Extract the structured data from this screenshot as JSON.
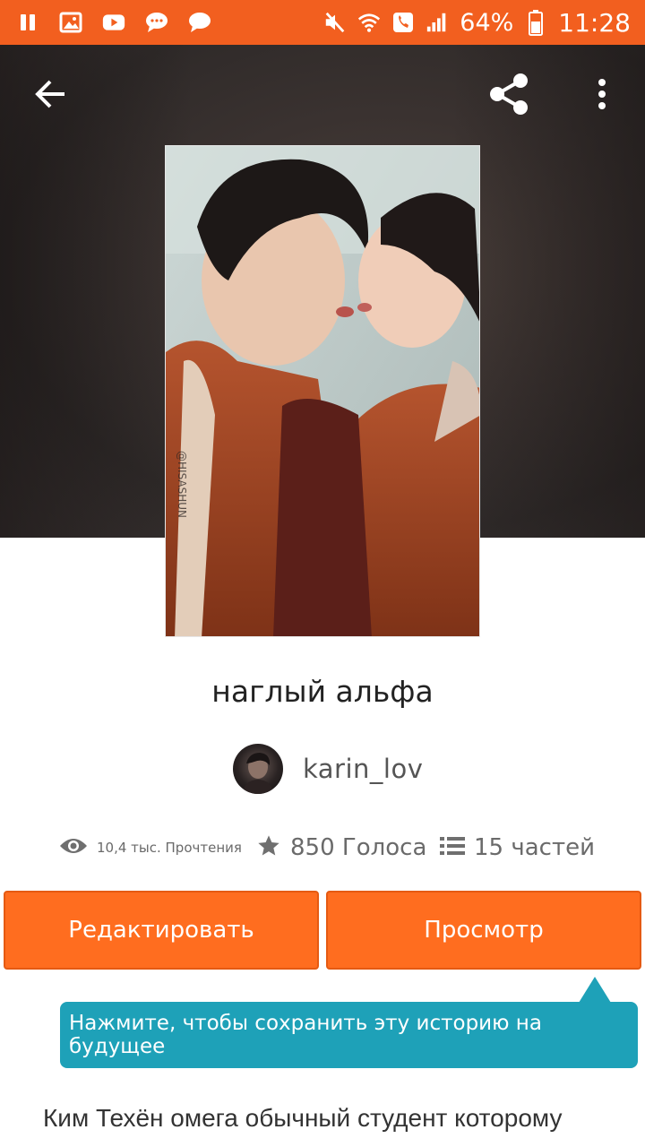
{
  "status_bar": {
    "battery_percent": "64%",
    "time": "11:28",
    "icons": [
      "pause-icon",
      "image-icon",
      "youtube-icon",
      "chat-bubble-icon",
      "chat-bubble-icon",
      "mute-icon",
      "wifi-icon",
      "wifi-call-icon",
      "signal-icon",
      "battery-icon"
    ]
  },
  "header": {
    "back_icon": "arrow-left-icon",
    "share_icon": "share-icon",
    "more_icon": "more-vertical-icon"
  },
  "story": {
    "cover_watermark": "@HISASHUN",
    "title": "наглый альфа",
    "author": "karin_lov",
    "stats": {
      "reads": "10,4 тыс. Прочтения",
      "votes": "850 Голоса",
      "parts": "15 частей"
    },
    "description_first_line": "Ким Техён омега обычный студент которому"
  },
  "actions": {
    "edit_label": "Редактировать",
    "view_label": "Просмотр"
  },
  "tooltip": {
    "text": "Нажмите, чтобы сохранить эту историю на будущее"
  },
  "colors": {
    "accent": "#ff6d1f",
    "status_bar": "#f25f1f",
    "tooltip": "#1ea1b8"
  }
}
